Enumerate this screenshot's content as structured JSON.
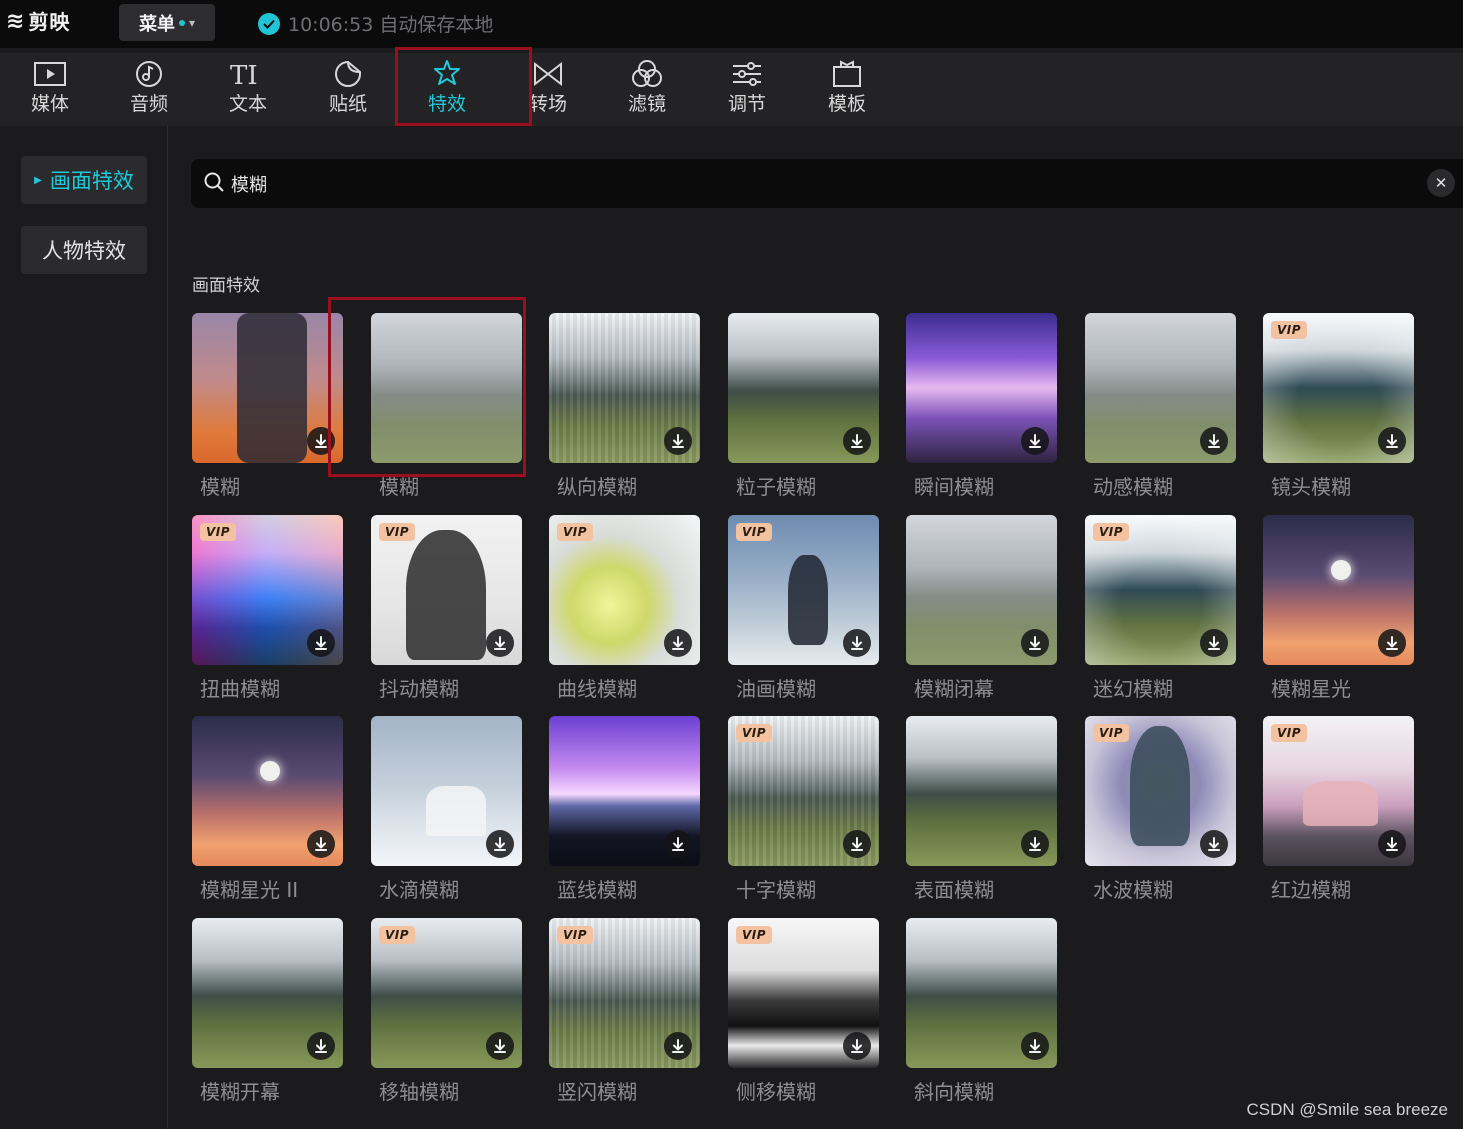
{
  "app": {
    "logo_text": "剪映",
    "logo_mark": "≋"
  },
  "titlebar": {
    "menu_label": "菜单",
    "status_text": "10:06:53 自动保存本地"
  },
  "toolbar": {
    "tabs": [
      {
        "label": "媒体",
        "icon": "media-icon"
      },
      {
        "label": "音频",
        "icon": "audio-icon"
      },
      {
        "label": "文本",
        "icon": "text-icon"
      },
      {
        "label": "贴纸",
        "icon": "sticker-icon"
      },
      {
        "label": "特效",
        "icon": "effects-icon",
        "active": true
      },
      {
        "label": "转场",
        "icon": "transition-icon"
      },
      {
        "label": "滤镜",
        "icon": "filter-icon"
      },
      {
        "label": "调节",
        "icon": "adjust-icon"
      },
      {
        "label": "模板",
        "icon": "template-icon"
      }
    ]
  },
  "sidebar": {
    "items": [
      {
        "label": "画面特效",
        "active": true
      },
      {
        "label": "人物特效",
        "active": false
      }
    ]
  },
  "search": {
    "value": "模糊",
    "placeholder": ""
  },
  "section": {
    "title": "画面特效"
  },
  "effects": [
    {
      "label": "模糊",
      "vip": false,
      "theme": "person"
    },
    {
      "label": "模糊",
      "vip": false,
      "theme": "deer-blur"
    },
    {
      "label": "纵向模糊",
      "vip": false,
      "theme": "deer-vertical"
    },
    {
      "label": "粒子模糊",
      "vip": false,
      "theme": "deer"
    },
    {
      "label": "瞬间模糊",
      "vip": false,
      "theme": "purple"
    },
    {
      "label": "动感模糊",
      "vip": false,
      "theme": "deer-blur"
    },
    {
      "label": "镜头模糊",
      "vip": true,
      "theme": "deer-lens"
    },
    {
      "label": "扭曲模糊",
      "vip": true,
      "theme": "rainbow"
    },
    {
      "label": "抖动模糊",
      "vip": true,
      "theme": "man"
    },
    {
      "label": "曲线模糊",
      "vip": true,
      "theme": "swirl"
    },
    {
      "label": "油画模糊",
      "vip": true,
      "theme": "dancer"
    },
    {
      "label": "模糊闭幕",
      "vip": false,
      "theme": "deer-blur"
    },
    {
      "label": "迷幻模糊",
      "vip": true,
      "theme": "deer-lens"
    },
    {
      "label": "模糊星光",
      "vip": false,
      "theme": "moon"
    },
    {
      "label": "模糊星光 II",
      "vip": false,
      "theme": "moon"
    },
    {
      "label": "水滴模糊",
      "vip": false,
      "theme": "snow"
    },
    {
      "label": "蓝线模糊",
      "vip": false,
      "theme": "concert"
    },
    {
      "label": "十字模糊",
      "vip": true,
      "theme": "deer-vertical"
    },
    {
      "label": "表面模糊",
      "vip": false,
      "theme": "deer"
    },
    {
      "label": "水波模糊",
      "vip": true,
      "theme": "hologram"
    },
    {
      "label": "红边模糊",
      "vip": true,
      "theme": "car"
    },
    {
      "label": "模糊开幕",
      "vip": false,
      "theme": "deer"
    },
    {
      "label": "移轴模糊",
      "vip": true,
      "theme": "deer"
    },
    {
      "label": "竖闪模糊",
      "vip": true,
      "theme": "deer-vertical"
    },
    {
      "label": "侧移模糊",
      "vip": true,
      "theme": "bw"
    },
    {
      "label": "斜向模糊",
      "vip": false,
      "theme": "deer"
    }
  ],
  "vip_badge": "VIP",
  "watermark": "CSDN @Smile sea breeze",
  "colors": {
    "accent": "#1fc9d9",
    "highlight_box": "#9a0f1d",
    "vip_badge": "#f3c2a1"
  }
}
